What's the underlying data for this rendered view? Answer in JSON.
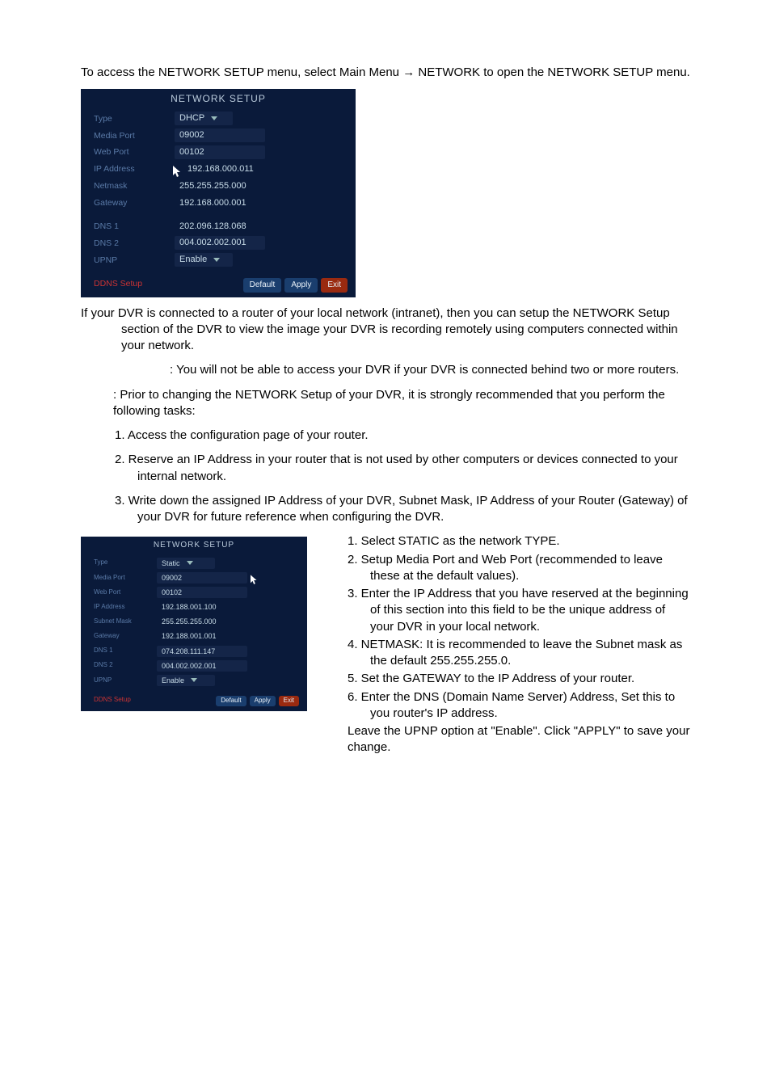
{
  "intro": {
    "line": "To access the NETWORK SETUP menu, select Main Menu → NETWORK to open the NETWORK SETUP menu."
  },
  "setup1": {
    "title": "NETWORK SETUP",
    "rows": {
      "type_label": "Type",
      "type_value": "DHCP",
      "media_port_label": "Media Port",
      "media_port_value": "09002",
      "web_port_label": "Web Port",
      "web_port_value": "00102",
      "ip_label": "IP Address",
      "ip_value": "192.168.000.011",
      "netmask_label": "Netmask",
      "netmask_value": "255.255.255.000",
      "gateway_label": "Gateway",
      "gateway_value": "192.168.000.001",
      "dns1_label": "DNS 1",
      "dns1_value": "202.096.128.068",
      "dns2_label": "DNS 2",
      "dns2_value": "004.002.002.001",
      "upnp_label": "UPNP",
      "upnp_value": "Enable",
      "ddns_label": "DDNS Setup"
    },
    "buttons": {
      "default": "Default",
      "apply": "Apply",
      "exit": "Exit"
    }
  },
  "body": {
    "p1": "If your DVR is connected to a router of your local network (intranet), then you can setup the NETWORK Setup section of the DVR to view the image your DVR is recording remotely using computers connected within your network.",
    "p2": ": You will not be able to access your DVR if your DVR is connected behind two or more routers.",
    "p3": ": Prior to changing the NETWORK Setup of your DVR, it is strongly recommended that you perform the following tasks:",
    "n1": "1.  Access the configuration page of your router.",
    "n2": "2.  Reserve an IP Address in your router that is not used by other computers or devices connected to your internal network.",
    "n3": "3.  Write down the assigned IP Address of your DVR, Subnet Mask, IP Address of your Router (Gateway) of your DVR for future reference when configuring the DVR."
  },
  "setup2": {
    "title": "NETWORK SETUP",
    "rows": {
      "type_label": "Type",
      "type_value": "Static",
      "media_port_label": "Media Port",
      "media_port_value": "09002",
      "web_port_label": "Web Port",
      "web_port_value": "00102",
      "ip_label": "IP Address",
      "ip_value": "192.188.001.100",
      "subnet_label": "Subnet Mask",
      "subnet_value": "255.255.255.000",
      "gateway_label": "Gateway",
      "gateway_value": "192.188.001.001",
      "dns1_label": "DNS 1",
      "dns1_value": "074.208.111.147",
      "dns2_label": "DNS 2",
      "dns2_value": "004.002.002.001",
      "upnp_label": "UPNP",
      "upnp_value": "Enable",
      "ddns_label": "DDNS Setup"
    },
    "buttons": {
      "default": "Default",
      "apply": "Apply",
      "exit": "Exit"
    }
  },
  "right": {
    "r1": "1.  Select STATIC as the network TYPE.",
    "r2": "2.  Setup Media Port and Web Port (recommended to leave these at the default values).",
    "r3": "3.  Enter the IP Address that you have reserved at the beginning of this section into this field to be the unique address of your DVR in your local network.",
    "r4": "4.  NETMASK: It is recommended to leave the Subnet mask as the default 255.255.255.0.",
    "r5": "5.  Set the GATEWAY to the IP Address of your router.",
    "r6": "6.  Enter the DNS (Domain Name Server) Address, Set this to you router's IP address.",
    "rp": "Leave the UPNP option at \"Enable\".   Click \"APPLY\" to save your change."
  }
}
